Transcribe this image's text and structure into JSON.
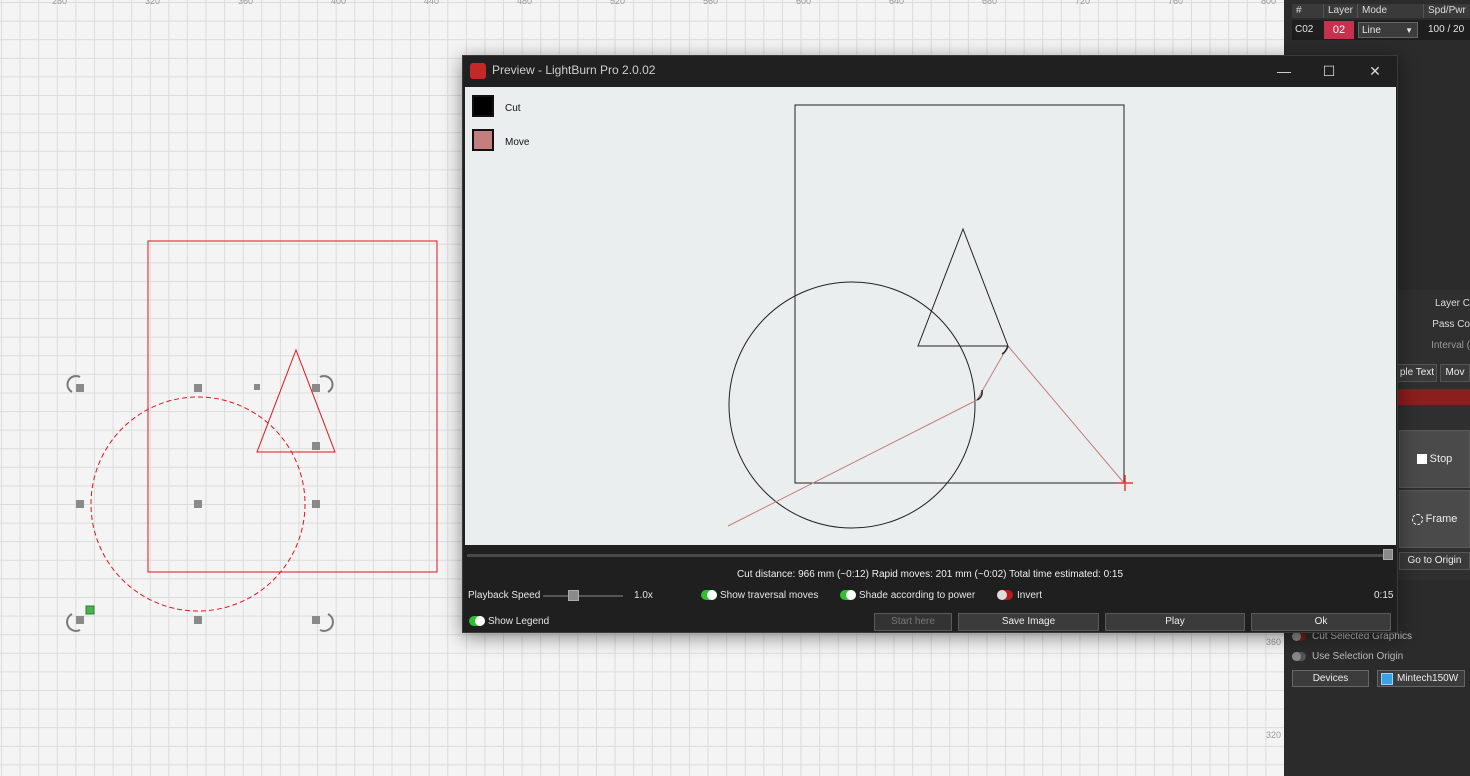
{
  "workspace": {
    "ruler_top": [
      "280",
      "320",
      "360",
      "400",
      "440",
      "480",
      "520",
      "560",
      "600",
      "640",
      "680",
      "720",
      "760",
      "800"
    ],
    "ruler_right": [
      "360",
      "320"
    ]
  },
  "cuts_panel": {
    "headers": [
      "#",
      "Layer",
      "Mode",
      "Spd/Pwr"
    ],
    "row": {
      "id": "C02",
      "layer": "02",
      "layer_color": "#c8314e",
      "mode": "Line",
      "spd_pwr": "100 / 20"
    },
    "labels": {
      "layer_count": "Layer C",
      "pass_count": "Pass Co",
      "interval": "Interval ("
    },
    "tabs": [
      "ple Text",
      "Mov"
    ],
    "buttons": {
      "stop": "Stop",
      "frame": "Frame",
      "go_to_origin": "Go to Origin"
    },
    "options": {
      "cut_selected": "Cut Selected Graphics",
      "use_selection_origin": "Use Selection Origin"
    },
    "devices_button": "Devices",
    "device_name": "Mintech150W"
  },
  "preview": {
    "title": "Preview - LightBurn Pro 2.0.02",
    "window_controls": {
      "minimize": "—",
      "maximize": "☐",
      "close": "✕"
    },
    "legend": [
      {
        "label": "Cut",
        "color": "#000000"
      },
      {
        "label": "Move",
        "color": "#c47e7e"
      }
    ],
    "stats": "Cut distance: 966 mm (~0:12)   Rapid moves: 201 mm (~0:02)   Total time estimated: 0:15",
    "playback_speed_label": "Playback Speed",
    "playback_speed_value": "1.0x",
    "toggles": {
      "show_traversal": "Show traversal moves",
      "shade_power": "Shade according to power",
      "invert": "Invert",
      "show_legend": "Show Legend"
    },
    "time_display": "0:15",
    "buttons": {
      "start_here": "Start here",
      "save_image": "Save Image",
      "play": "Play",
      "ok": "Ok"
    }
  }
}
